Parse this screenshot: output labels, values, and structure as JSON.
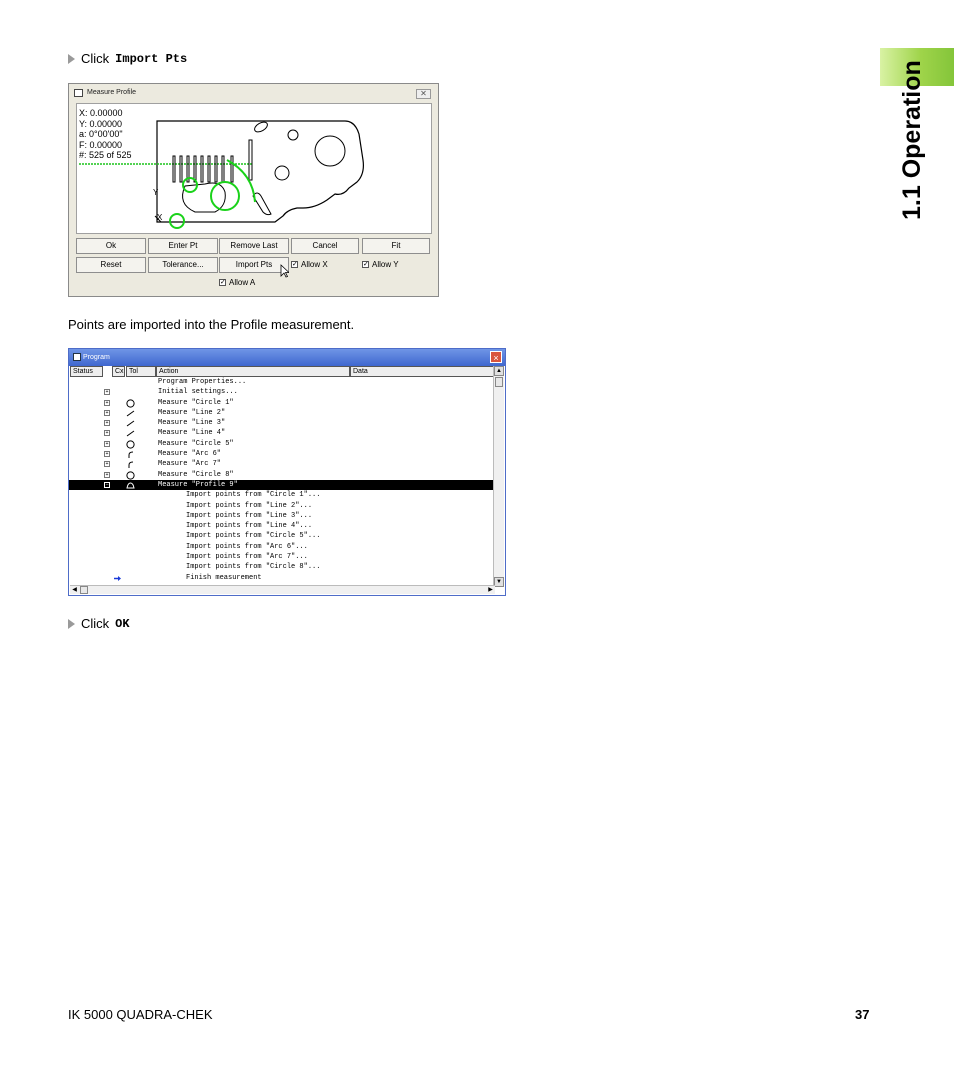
{
  "side": {
    "title": "1.1 Operation"
  },
  "steps": {
    "click1_prefix": "Click",
    "click1_target": "Import Pts",
    "click2_prefix": "Click",
    "click2_target": "OK"
  },
  "paragraph": "Points are imported into the Profile measurement.",
  "measure_dialog": {
    "title": "Measure Profile",
    "close": "✕",
    "readout": [
      "X: 0.00000",
      "Y: 0.00000",
      "a: 0°00'00\"",
      "F: 0.00000",
      "#: 525 of 525"
    ],
    "axis_y": "Y",
    "axis_x": "X",
    "buttons": {
      "ok": "Ok",
      "enter_pt": "Enter Pt",
      "remove_last": "Remove Last",
      "cancel": "Cancel",
      "fit": "Fit",
      "reset": "Reset",
      "tolerance": "Tolerance...",
      "import_pts": "Import Pts"
    },
    "checks": {
      "allow_x": "Allow X",
      "allow_y": "Allow Y",
      "allow_a": "Allow A"
    }
  },
  "program_window": {
    "title": "Program",
    "close": "×",
    "headers": [
      "Status",
      "Cx",
      "Tol",
      "Action",
      "Data"
    ],
    "rows": [
      {
        "exp": "",
        "icon": "",
        "text": "Program Properties...",
        "indent": 0
      },
      {
        "exp": "+",
        "icon": "",
        "text": "Initial settings...",
        "indent": 0
      },
      {
        "exp": "+",
        "icon": "circle",
        "text": "Measure \"Circle 1\"",
        "indent": 0
      },
      {
        "exp": "+",
        "icon": "line",
        "text": "Measure \"Line 2\"",
        "indent": 0
      },
      {
        "exp": "+",
        "icon": "line",
        "text": "Measure \"Line 3\"",
        "indent": 0
      },
      {
        "exp": "+",
        "icon": "line",
        "text": "Measure \"Line 4\"",
        "indent": 0
      },
      {
        "exp": "+",
        "icon": "circle",
        "text": "Measure \"Circle 5\"",
        "indent": 0
      },
      {
        "exp": "+",
        "icon": "arc",
        "text": "Measure \"Arc 6\"",
        "indent": 0
      },
      {
        "exp": "+",
        "icon": "arc",
        "text": "Measure \"Arc 7\"",
        "indent": 0
      },
      {
        "exp": "+",
        "icon": "circle",
        "text": "Measure \"Circle 8\"",
        "indent": 0
      },
      {
        "exp": "−",
        "icon": "profile",
        "text": "Measure \"Profile 9\"",
        "indent": 0,
        "selected": true
      },
      {
        "exp": "",
        "icon": "",
        "text": "Import points from \"Circle 1\"...",
        "indent": 1
      },
      {
        "exp": "",
        "icon": "",
        "text": "Import points from \"Line 2\"...",
        "indent": 1
      },
      {
        "exp": "",
        "icon": "",
        "text": "Import points from \"Line 3\"...",
        "indent": 1
      },
      {
        "exp": "",
        "icon": "",
        "text": "Import points from \"Line 4\"...",
        "indent": 1
      },
      {
        "exp": "",
        "icon": "",
        "text": "Import points from \"Circle 5\"...",
        "indent": 1
      },
      {
        "exp": "",
        "icon": "",
        "text": "Import points from \"Arc 6\"...",
        "indent": 1
      },
      {
        "exp": "",
        "icon": "",
        "text": "Import points from \"Arc 7\"...",
        "indent": 1
      },
      {
        "exp": "",
        "icon": "",
        "text": "Import points from \"Circle 8\"...",
        "indent": 1
      },
      {
        "exp": "",
        "icon": "arrow",
        "text": "Finish measurement",
        "indent": 1
      }
    ]
  },
  "footer": {
    "left": "IK 5000 QUADRA-CHEK",
    "page": "37"
  }
}
